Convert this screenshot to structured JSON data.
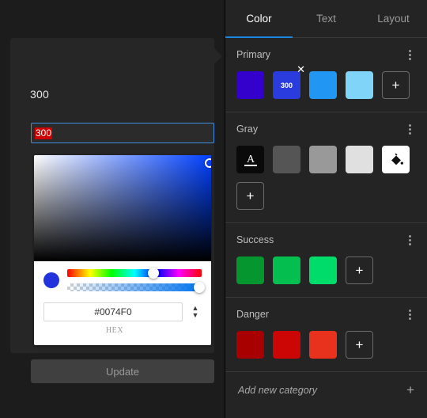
{
  "left_panel": {
    "popover_title": "300",
    "name_input": {
      "value": "300",
      "selected": true
    },
    "color_picker": {
      "hex_value": "#0074F0",
      "hex_label": "HEX",
      "preview_color": "#2233dd",
      "stepper_up": "▲",
      "stepper_down": "▼"
    },
    "update_button": "Update"
  },
  "right_panel": {
    "tabs": [
      {
        "label": "Color",
        "active": true
      },
      {
        "label": "Text",
        "active": false
      },
      {
        "label": "Layout",
        "active": false
      }
    ],
    "sections": [
      {
        "title": "Primary",
        "swatches": [
          {
            "color": "#3300CC",
            "label": "",
            "closable": false
          },
          {
            "color": "#2B3CDF",
            "label": "300",
            "closable": true
          },
          {
            "color": "#2196F3",
            "label": "",
            "closable": false
          },
          {
            "color": "#7FD4F7",
            "label": "",
            "closable": false
          }
        ],
        "add_label": "+"
      },
      {
        "title": "Gray",
        "swatches": [
          {
            "color": "#0A0A0A",
            "label": "",
            "closable": false,
            "icon": "text-color-icon"
          },
          {
            "color": "#555555",
            "label": "",
            "closable": false
          },
          {
            "color": "#999999",
            "label": "",
            "closable": false
          },
          {
            "color": "#E0E0E0",
            "label": "",
            "closable": false
          },
          {
            "color": "#FFFFFF",
            "label": "",
            "closable": false,
            "icon": "fill-bucket-icon"
          }
        ],
        "add_label": "+"
      },
      {
        "title": "Success",
        "swatches": [
          {
            "color": "#069630",
            "label": "",
            "closable": false
          },
          {
            "color": "#04BF4F",
            "label": "",
            "closable": false
          },
          {
            "color": "#00DC69",
            "label": "",
            "closable": false
          }
        ],
        "add_label": "+"
      },
      {
        "title": "Danger",
        "swatches": [
          {
            "color": "#A80000",
            "label": "",
            "closable": false
          },
          {
            "color": "#CC0505",
            "label": "",
            "closable": false
          },
          {
            "color": "#E8321E",
            "label": "",
            "closable": false
          }
        ],
        "add_label": "+"
      }
    ],
    "footer": {
      "text": "Add new category",
      "plus": "+"
    }
  },
  "colors": {
    "accent": "#1a86e0",
    "panel_bg": "#242424",
    "popover_bg": "#262626",
    "selection_red": "#cc0000"
  }
}
